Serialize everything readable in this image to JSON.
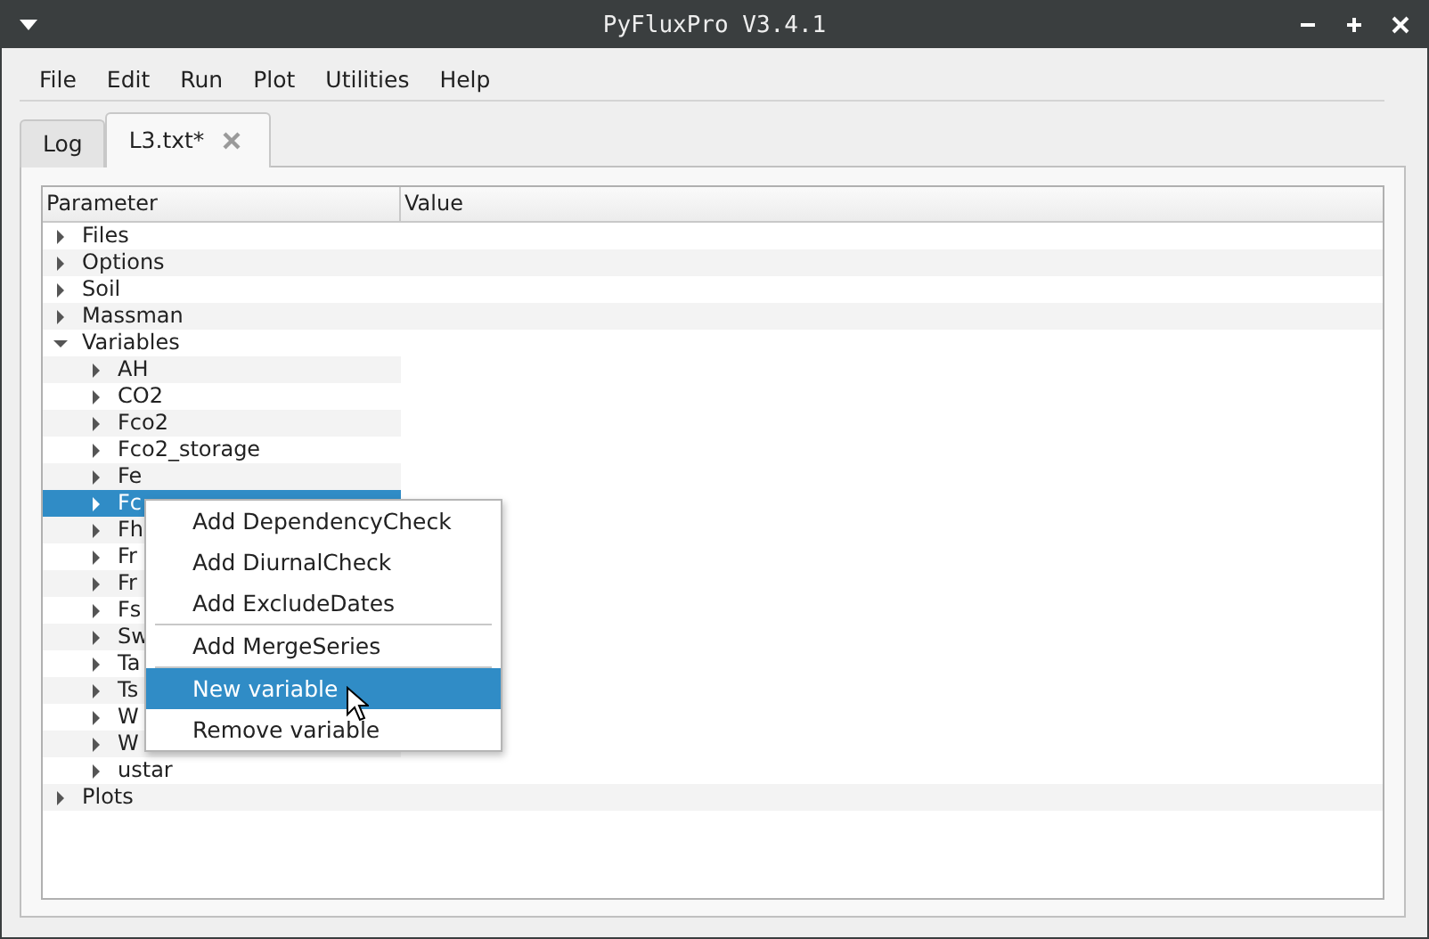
{
  "window": {
    "title": "PyFluxPro V3.4.1"
  },
  "menu_bar": [
    "File",
    "Edit",
    "Run",
    "Plot",
    "Utilities",
    "Help"
  ],
  "tabs": [
    {
      "label": "Log",
      "selected": false,
      "closable": false
    },
    {
      "label": "L3.txt*",
      "selected": true,
      "closable": true
    }
  ],
  "tree": {
    "columns": [
      "Parameter",
      "Value"
    ],
    "items": [
      {
        "label": "Files",
        "expanded": false,
        "selected": false
      },
      {
        "label": "Options",
        "expanded": false,
        "selected": false
      },
      {
        "label": "Soil",
        "expanded": false,
        "selected": false
      },
      {
        "label": "Massman",
        "expanded": false,
        "selected": false
      },
      {
        "label": "Variables",
        "expanded": true,
        "selected": false,
        "children": [
          {
            "label": "AH",
            "expanded": false,
            "selected": false
          },
          {
            "label": "CO2",
            "expanded": false,
            "selected": false
          },
          {
            "label": "Fco2",
            "expanded": false,
            "selected": false
          },
          {
            "label": "Fco2_storage",
            "expanded": false,
            "selected": false
          },
          {
            "label": "Fe",
            "expanded": false,
            "selected": false
          },
          {
            "label": "Fc",
            "expanded": false,
            "selected": true
          },
          {
            "label": "Fh",
            "expanded": false,
            "selected": false
          },
          {
            "label": "Fr",
            "expanded": false,
            "selected": false
          },
          {
            "label": "Fr",
            "expanded": false,
            "selected": false
          },
          {
            "label": "Fs",
            "expanded": false,
            "selected": false
          },
          {
            "label": "Sw",
            "expanded": false,
            "selected": false
          },
          {
            "label": "Ta",
            "expanded": false,
            "selected": false
          },
          {
            "label": "Ts",
            "expanded": false,
            "selected": false
          },
          {
            "label": "W",
            "expanded": false,
            "selected": false
          },
          {
            "label": "W",
            "expanded": false,
            "selected": false
          },
          {
            "label": "ustar",
            "expanded": false,
            "selected": false
          }
        ]
      },
      {
        "label": "Plots",
        "expanded": false,
        "selected": false
      }
    ]
  },
  "context_menu": [
    {
      "kind": "action",
      "label": "Add DependencyCheck",
      "selected": false
    },
    {
      "kind": "action",
      "label": "Add DiurnalCheck",
      "selected": false
    },
    {
      "kind": "action",
      "label": "Add ExcludeDates",
      "selected": false
    },
    {
      "kind": "separator"
    },
    {
      "kind": "action",
      "label": "Add MergeSeries",
      "selected": false
    },
    {
      "kind": "separator"
    },
    {
      "kind": "action",
      "label": "New variable",
      "selected": true
    },
    {
      "kind": "action",
      "label": "Remove variable",
      "selected": false
    }
  ]
}
